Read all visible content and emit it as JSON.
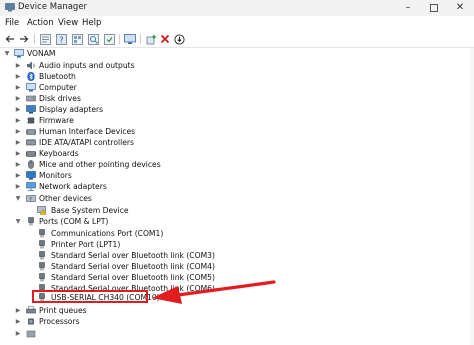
{
  "window": {
    "title": "Device Manager",
    "icon": "device-manager-icon",
    "controls": [
      "minimize-icon",
      "maximize-icon",
      "close-icon"
    ]
  },
  "menu": [
    "File",
    "Action",
    "View",
    "Help"
  ],
  "toolbar": [
    "back-arrow-icon",
    "forward-arrow-icon",
    "properties-icon",
    "help-icon",
    "show-hidden-icon",
    "scan-hardware-icon",
    "update-driver-icon",
    "disable-device-icon",
    "uninstall-icon",
    "add-driver-icon"
  ],
  "tree": {
    "root": "VONAM",
    "categories": [
      {
        "label": "Audio inputs and outputs",
        "icon": "speaker-icon"
      },
      {
        "label": "Bluetooth",
        "icon": "bluetooth-icon"
      },
      {
        "label": "Computer",
        "icon": "computer-icon"
      },
      {
        "label": "Disk drives",
        "icon": "disk-icon"
      },
      {
        "label": "Display adapters",
        "icon": "display-icon"
      },
      {
        "label": "Firmware",
        "icon": "chip-icon"
      },
      {
        "label": "Human Interface Devices",
        "icon": "hid-icon"
      },
      {
        "label": "IDE ATA/ATAPI controllers",
        "icon": "controller-icon"
      },
      {
        "label": "Keyboards",
        "icon": "keyboard-icon"
      },
      {
        "label": "Mice and other pointing devices",
        "icon": "mouse-icon"
      },
      {
        "label": "Monitors",
        "icon": "monitor-icon"
      },
      {
        "label": "Network adapters",
        "icon": "network-icon"
      }
    ],
    "other_devices": {
      "label": "Other devices",
      "children": [
        "Base System Device"
      ]
    },
    "ports": {
      "label": "Ports (COM & LPT)",
      "children": [
        "Communications Port (COM1)",
        "Printer Port (LPT1)",
        "Standard Serial over Bluetooth link (COM3)",
        "Standard Serial over Bluetooth link (COM4)",
        "Standard Serial over Bluetooth link (COM5)",
        "Standard Serial over Bluetooth link (COM6)",
        "USB-SERIAL CH340 (COM10)"
      ]
    },
    "after": [
      {
        "label": "Print queues",
        "icon": "printer-icon"
      },
      {
        "label": "Processors",
        "icon": "processor-icon"
      }
    ]
  },
  "annotation": {
    "highlight_color": "#e21c21"
  }
}
